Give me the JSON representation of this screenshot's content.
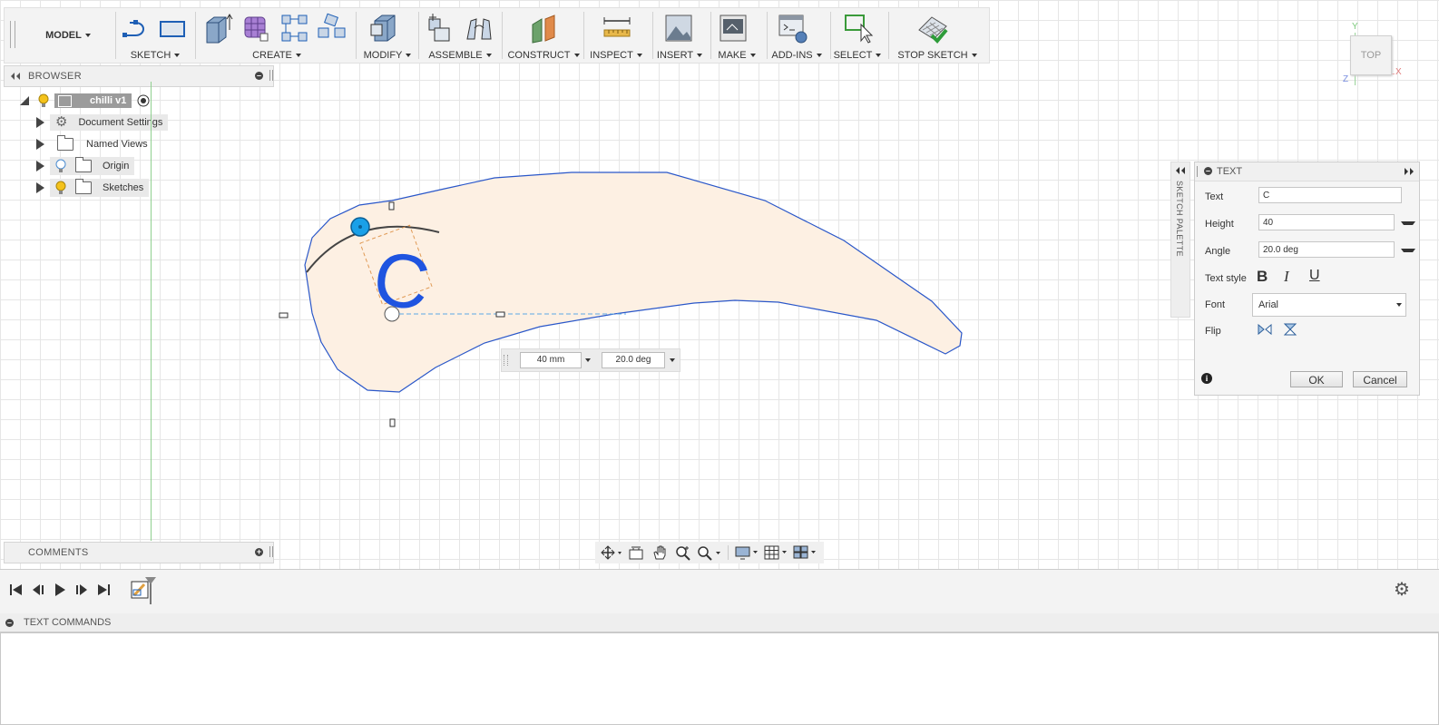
{
  "toolbar": {
    "workspace": "MODEL",
    "groups": [
      "SKETCH",
      "CREATE",
      "MODIFY",
      "ASSEMBLE",
      "CONSTRUCT",
      "INSPECT",
      "INSERT",
      "MAKE",
      "ADD-INS",
      "SELECT",
      "STOP SKETCH"
    ]
  },
  "browser": {
    "title": "BROWSER",
    "root": "chilli v1",
    "items": [
      "Document Settings",
      "Named Views",
      "Origin",
      "Sketches"
    ]
  },
  "comments": {
    "title": "COMMENTS"
  },
  "viewcube": {
    "face": "TOP",
    "axis_x": "X",
    "axis_y": "Y",
    "axis_z": "Z"
  },
  "palette": {
    "title": "SKETCH PALETTE"
  },
  "dialog": {
    "title": "TEXT",
    "text_label": "Text",
    "text_value": "C",
    "height_label": "Height",
    "height_value": "40",
    "angle_label": "Angle",
    "angle_value": "20.0 deg",
    "style_label": "Text style",
    "bold": "B",
    "italic": "I",
    "underline": "U",
    "font_label": "Font",
    "font_value": "Arial",
    "flip_label": "Flip",
    "ok": "OK",
    "cancel": "Cancel"
  },
  "canvas": {
    "letter": "C",
    "height_input": "40 mm",
    "angle_input": "20.0 deg"
  },
  "bottom": {
    "text_commands": "TEXT COMMANDS"
  }
}
